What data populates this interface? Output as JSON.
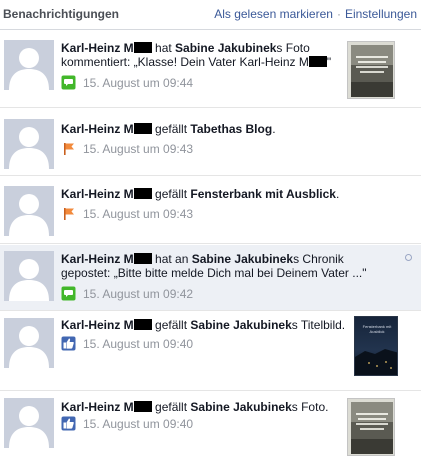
{
  "header": {
    "title": "Benachrichtigungen",
    "mark_read": "Als gelesen markieren",
    "separator": "·",
    "settings": "Einstellungen"
  },
  "colors": {
    "link": "#3b5998",
    "unread_bg": "#edf0f5",
    "comment_icon": "#42b72a",
    "like_icon": "#4267b2",
    "page_icon": "#f28a3c"
  },
  "notifications": [
    {
      "actor": "Karl-Heinz M",
      "p1": " hat ",
      "b2": "Sabine Jakubinek",
      "p2": "s Foto kommentiert: „Klasse! Dein Vater Karl-Heinz M",
      "p3": "\"",
      "icon": "comment-icon",
      "time": "15. August um 09:44"
    },
    {
      "actor": "Karl-Heinz M",
      "p1": " gefällt ",
      "b2": "Tabethas Blog",
      "p2": ".",
      "icon": "flag-icon",
      "time": "15. August um 09:43"
    },
    {
      "actor": "Karl-Heinz M",
      "p1": " gefällt ",
      "b2": "Fensterbank mit Ausblick",
      "p2": ".",
      "icon": "flag-icon",
      "time": "15. August um 09:43"
    },
    {
      "actor": "Karl-Heinz M",
      "p1": " hat an ",
      "b2": "Sabine Jakubinek",
      "p2": "s Chronik gepostet: „Bitte bitte melde Dich mal bei Deinem Vater ...\"",
      "icon": "comment-icon",
      "time": "15. August um 09:42"
    },
    {
      "actor": "Karl-Heinz M",
      "p1": " gefällt ",
      "b2": "Sabine Jakubinek",
      "p2": "s Titelbild.",
      "icon": "like-icon",
      "time": "15. August um 09:40",
      "thumb_text": "Fensterbank mit Ausblick"
    },
    {
      "actor": "Karl-Heinz M",
      "p1": " gefällt ",
      "b2": "Sabine Jakubinek",
      "p2": "s Foto.",
      "icon": "like-icon",
      "time": "15. August um 09:40"
    }
  ]
}
